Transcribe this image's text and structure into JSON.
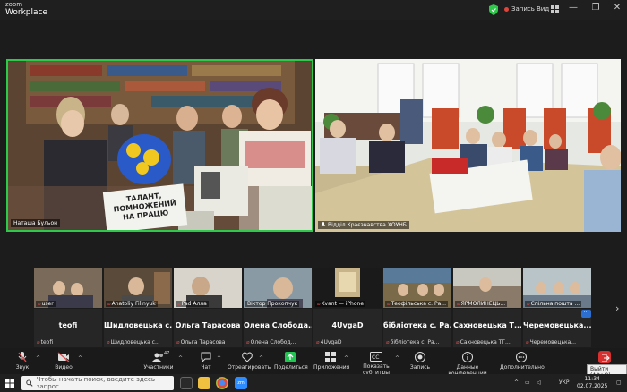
{
  "titlebar": {
    "brand_line1": "zoom",
    "brand_line2": "Workplace",
    "recording_label": "Запись",
    "view_label": "Вид",
    "min": "—",
    "max": "❐",
    "close": "✕"
  },
  "main_videos": [
    {
      "name": "Наташа Бульон",
      "muted": true
    },
    {
      "name": "Відділ Краєзнавства ХОУНБ",
      "muted": false
    }
  ],
  "poster_text": [
    "ТАЛАНТ,",
    "ПОМНОЖЕНИЙ",
    "НА ПРАЦЮ"
  ],
  "thumbnails": [
    {
      "label": "user",
      "muted": true
    },
    {
      "label": "Anatoliy Filinyuk",
      "muted": true
    },
    {
      "label": "Pad Алла",
      "muted": true
    },
    {
      "label": "Віктор Прокопчук",
      "muted": false
    },
    {
      "label": "Kvant — iPhone",
      "muted": true
    },
    {
      "label": "Теофільська с. Ра...",
      "muted": true
    },
    {
      "label": "ЯРМОЛИНЕЦЬ...",
      "muted": true
    },
    {
      "label": "Спільна пошта ...",
      "muted": true
    }
  ],
  "name_tiles": [
    {
      "big": "teofi",
      "small": "teofi"
    },
    {
      "big": "Шидловецька с...",
      "small": "Шидловецька с..."
    },
    {
      "big": "Ольга Тарасова",
      "small": "Ольга Тарасова"
    },
    {
      "big": "Олена Слобода...",
      "small": "Олена Слобод..."
    },
    {
      "big": "4UvgaD",
      "small": "4UvgaD"
    },
    {
      "big": "бібліотека с. Ра...",
      "small": "бібліотека с. Ра..."
    },
    {
      "big": "Сахновецька Т...",
      "small": "Сахновецька ТГ..."
    },
    {
      "big": "Черемовецька...",
      "small": "Черемовецька..."
    }
  ],
  "toolbar": {
    "audio": "Звук",
    "video": "Видео",
    "participants": "Участники",
    "participants_count": "47",
    "chat": "Чат",
    "react": "Отреагировать",
    "share": "Поделиться",
    "apps": "Приложения",
    "captions": "Показать субтитры",
    "record": "Запись",
    "conf_data": "Данные конференции",
    "more": "Дополнительно",
    "leave_tooltip": "Выйти (Alt+Q)"
  },
  "taskbar": {
    "search_placeholder": "Чтобы начать поиск, введите здесь запрос",
    "lang": "УКР",
    "time": "11:34",
    "date": "02.07.2025"
  },
  "colors": {
    "active_speaker": "#2ec94a",
    "record_red": "#e0443a",
    "share_green": "#23c552"
  }
}
